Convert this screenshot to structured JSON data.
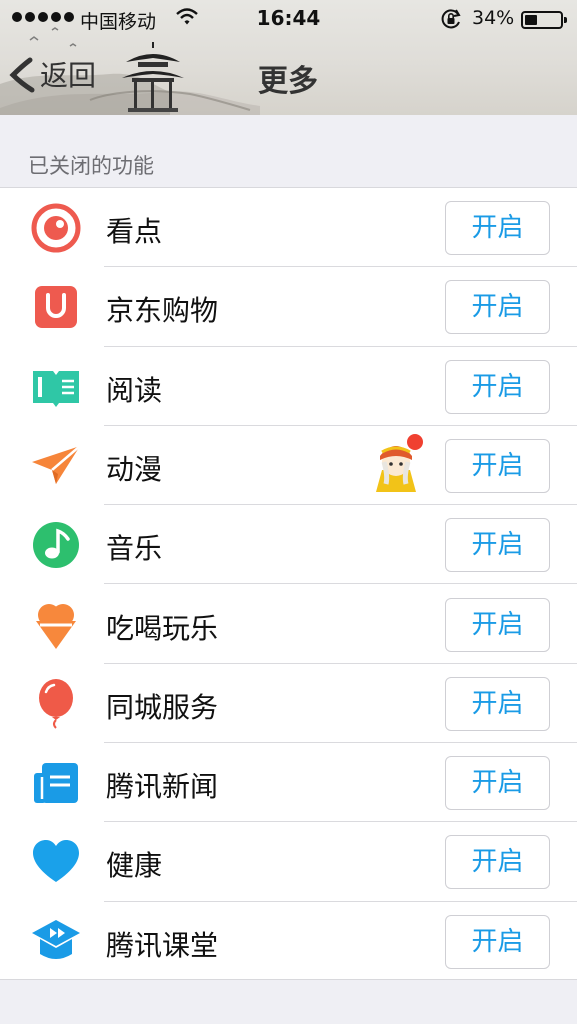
{
  "status": {
    "carrier": "中国移动",
    "time": "16:44",
    "battery": "34%",
    "battery_level": 0.34
  },
  "nav": {
    "back_label": "返回",
    "title": "更多"
  },
  "section": {
    "header": "已关闭的功能"
  },
  "items": [
    {
      "label": "看点",
      "button": "开启",
      "icon": "eye-icon",
      "color": "#ee5a4f"
    },
    {
      "label": "京东购物",
      "button": "开启",
      "icon": "shopping-bag-icon",
      "color": "#ee5a4f"
    },
    {
      "label": "阅读",
      "button": "开启",
      "icon": "book-icon",
      "color": "#2fc7a6"
    },
    {
      "label": "动漫",
      "button": "开启",
      "icon": "paper-plane-icon",
      "color": "#f6853a"
    },
    {
      "label": "音乐",
      "button": "开启",
      "icon": "music-note-icon",
      "color": "#2dbf6e"
    },
    {
      "label": "吃喝玩乐",
      "button": "开启",
      "icon": "ice-cream-icon",
      "color": "#f7883c"
    },
    {
      "label": "同城服务",
      "button": "开启",
      "icon": "balloon-icon",
      "color": "#ef5a48"
    },
    {
      "label": "腾讯新闻",
      "button": "开启",
      "icon": "newspaper-icon",
      "color": "#1a9be6"
    },
    {
      "label": "健康",
      "button": "开启",
      "icon": "heart-icon",
      "color": "#1aa1ea"
    },
    {
      "label": "腾讯课堂",
      "button": "开启",
      "icon": "graduation-cap-icon",
      "color": "#1a9be6"
    }
  ]
}
